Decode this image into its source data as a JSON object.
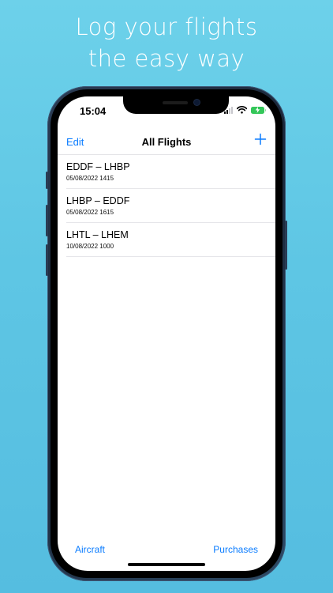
{
  "headline": {
    "line1": "Log your flights",
    "line2": "the easy way"
  },
  "status_bar": {
    "time": "15:04",
    "battery_color": "#34c759",
    "icons": [
      "cellular-signal-icon",
      "wifi-icon",
      "battery-charging-icon"
    ]
  },
  "nav": {
    "edit_label": "Edit",
    "title": "All Flights",
    "add_icon": "plus-icon",
    "accent_color": "#0a7cff"
  },
  "flights": [
    {
      "route": "EDDF – LHBP",
      "datetime": "05/08/2022 1415"
    },
    {
      "route": "LHBP – EDDF",
      "datetime": "05/08/2022 1615"
    },
    {
      "route": "LHTL – LHEM",
      "datetime": "10/08/2022 1000"
    }
  ],
  "toolbar": {
    "aircraft_label": "Aircraft",
    "purchases_label": "Purchases"
  }
}
